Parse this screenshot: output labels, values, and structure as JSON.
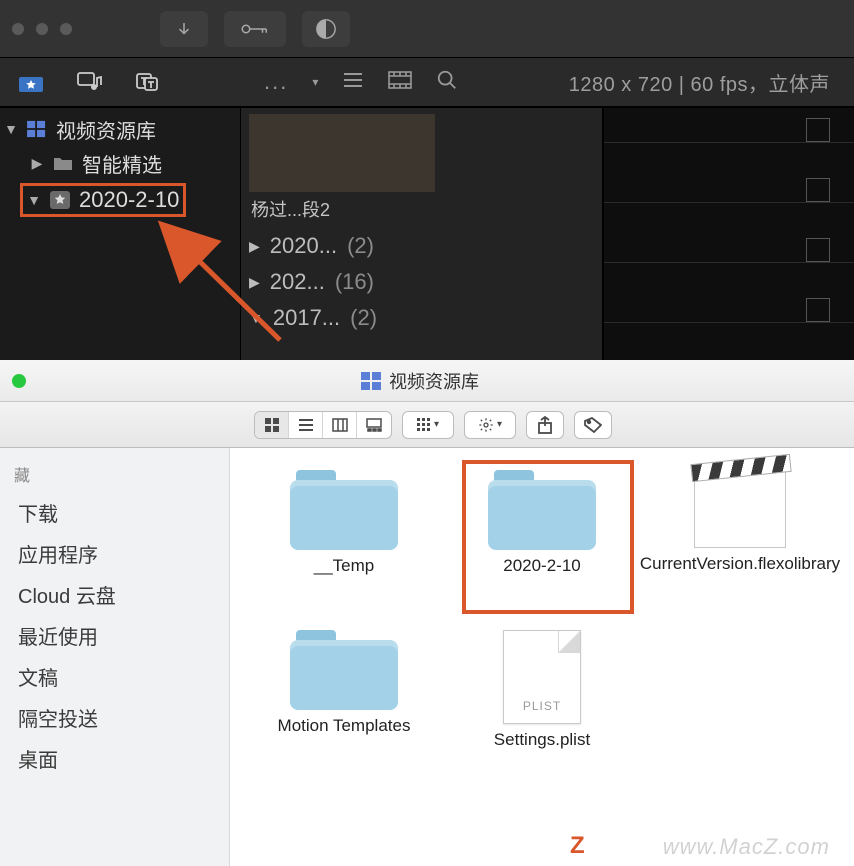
{
  "fcp": {
    "media_info": "1280 x 720 | 60 fps，立体声",
    "sidebar": {
      "root": "视频资源库",
      "smart": "智能精选",
      "event": "2020-2-10"
    },
    "browser": {
      "clip_label": "杨过...段2",
      "rows": [
        {
          "tri": "▶",
          "name": "2020...",
          "count": "(2)"
        },
        {
          "tri": "▶",
          "name": "202...",
          "count": "(16)"
        },
        {
          "tri": "▼",
          "name": "2017...",
          "count": "(2)"
        }
      ]
    }
  },
  "finder": {
    "window_title": "视频资源库",
    "sidebar": {
      "category": "藏",
      "items": [
        "下载",
        "应用程序",
        "Cloud 云盘",
        "最近使用",
        "文稿",
        "隔空投送",
        "桌面"
      ]
    },
    "files": [
      {
        "name": "__Temp",
        "type": "folder"
      },
      {
        "name": "2020-2-10",
        "type": "folder",
        "highlight": true
      },
      {
        "name": "CurrentVersion.flexolibrary",
        "type": "clapper"
      },
      {
        "name": "Motion Templates",
        "type": "folder"
      },
      {
        "name": "Settings.plist",
        "type": "plist"
      }
    ],
    "plist_tag": "PLIST"
  },
  "watermark": "www.MacZ.com"
}
